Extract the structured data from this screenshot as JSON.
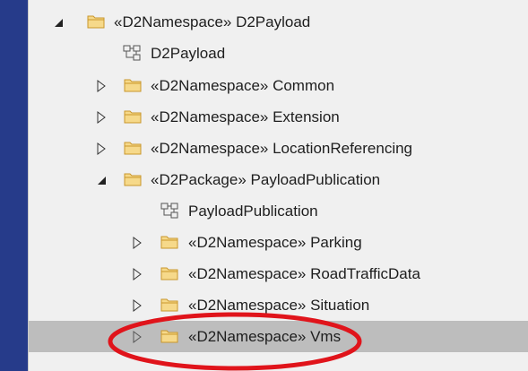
{
  "tree": {
    "rows": [
      {
        "text": "«D2Namespace» D2Payload",
        "expander": "expanded",
        "icon": "folder-icon",
        "selected": false
      },
      {
        "text": "D2Payload",
        "expander": "none",
        "icon": "diagram-icon",
        "selected": false
      },
      {
        "text": "«D2Namespace» Common",
        "expander": "collapsed",
        "icon": "folder-icon",
        "selected": false
      },
      {
        "text": "«D2Namespace» Extension",
        "expander": "collapsed",
        "icon": "folder-icon",
        "selected": false
      },
      {
        "text": "«D2Namespace» LocationReferencing",
        "expander": "collapsed",
        "icon": "folder-icon",
        "selected": false
      },
      {
        "text": "«D2Package» PayloadPublication",
        "expander": "expanded",
        "icon": "folder-icon",
        "selected": false
      },
      {
        "text": "PayloadPublication",
        "expander": "none",
        "icon": "diagram-icon",
        "selected": false
      },
      {
        "text": "«D2Namespace» Parking",
        "expander": "collapsed",
        "icon": "folder-icon",
        "selected": false
      },
      {
        "text": "«D2Namespace» RoadTrafficData",
        "expander": "collapsed",
        "icon": "folder-icon",
        "selected": false
      },
      {
        "text": "«D2Namespace» Situation",
        "expander": "collapsed",
        "icon": "folder-icon",
        "selected": false
      },
      {
        "text": "«D2Namespace» Vms",
        "expander": "collapsed",
        "icon": "folder-icon",
        "selected": true
      }
    ]
  },
  "colors": {
    "background": "#263b8a",
    "panel": "#f0f0f0",
    "selected_row": "#bdbdbd",
    "folder": "#e8b94a",
    "highlight_ellipse": "#e0141b"
  }
}
